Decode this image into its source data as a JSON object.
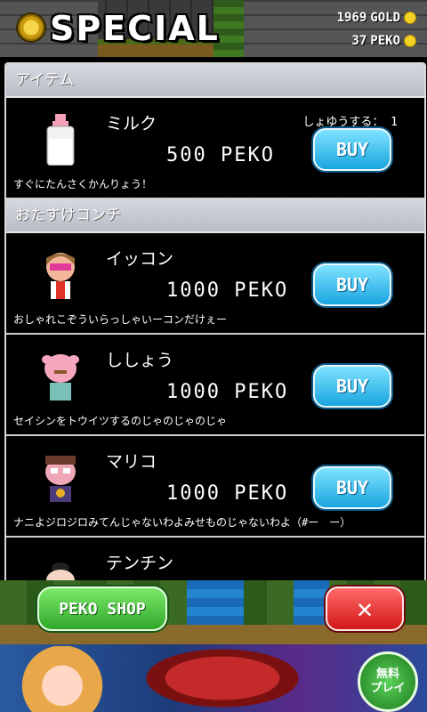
{
  "header": {
    "title": "SPECIAL",
    "gold_amount": "1969",
    "gold_label": "GOLD",
    "peko_amount": "37",
    "peko_label": "PEKO"
  },
  "sections": {
    "items_title": "アイテム",
    "helpers_title": "おたすけコンチ"
  },
  "items": [
    {
      "name": "ミルク",
      "price": "500 PEKO",
      "owned": "しょゆうする： 1",
      "desc": "すぐにたんさくかんりょう！",
      "buy": "BUY"
    }
  ],
  "helpers": [
    {
      "name": "イッコン",
      "price": "1000 PEKO",
      "desc": "おしゃれこぞういらっしゃいーコンだけぇー",
      "buy": "BUY"
    },
    {
      "name": "ししょう",
      "price": "1000 PEKO",
      "desc": "セイシンをトウイツするのじゃのじゃのじゃ",
      "buy": "BUY"
    },
    {
      "name": "マリコ",
      "price": "1000 PEKO",
      "desc": "ナニよジロジロみてんじゃないわよみせものじゃないわよ（#ー　ー）",
      "buy": "BUY"
    },
    {
      "name": "テンチン",
      "price": "",
      "desc": "",
      "buy": ""
    }
  ],
  "footer": {
    "peko_shop": "PEKO SHOP",
    "close": "✕"
  },
  "ad": {
    "play_line1": "無料",
    "play_line2": "プレイ"
  },
  "colors": {
    "buy": "#1aa5e0",
    "peko_shop": "#2fa82a",
    "close": "#d31818",
    "coin": "#f3d226"
  }
}
